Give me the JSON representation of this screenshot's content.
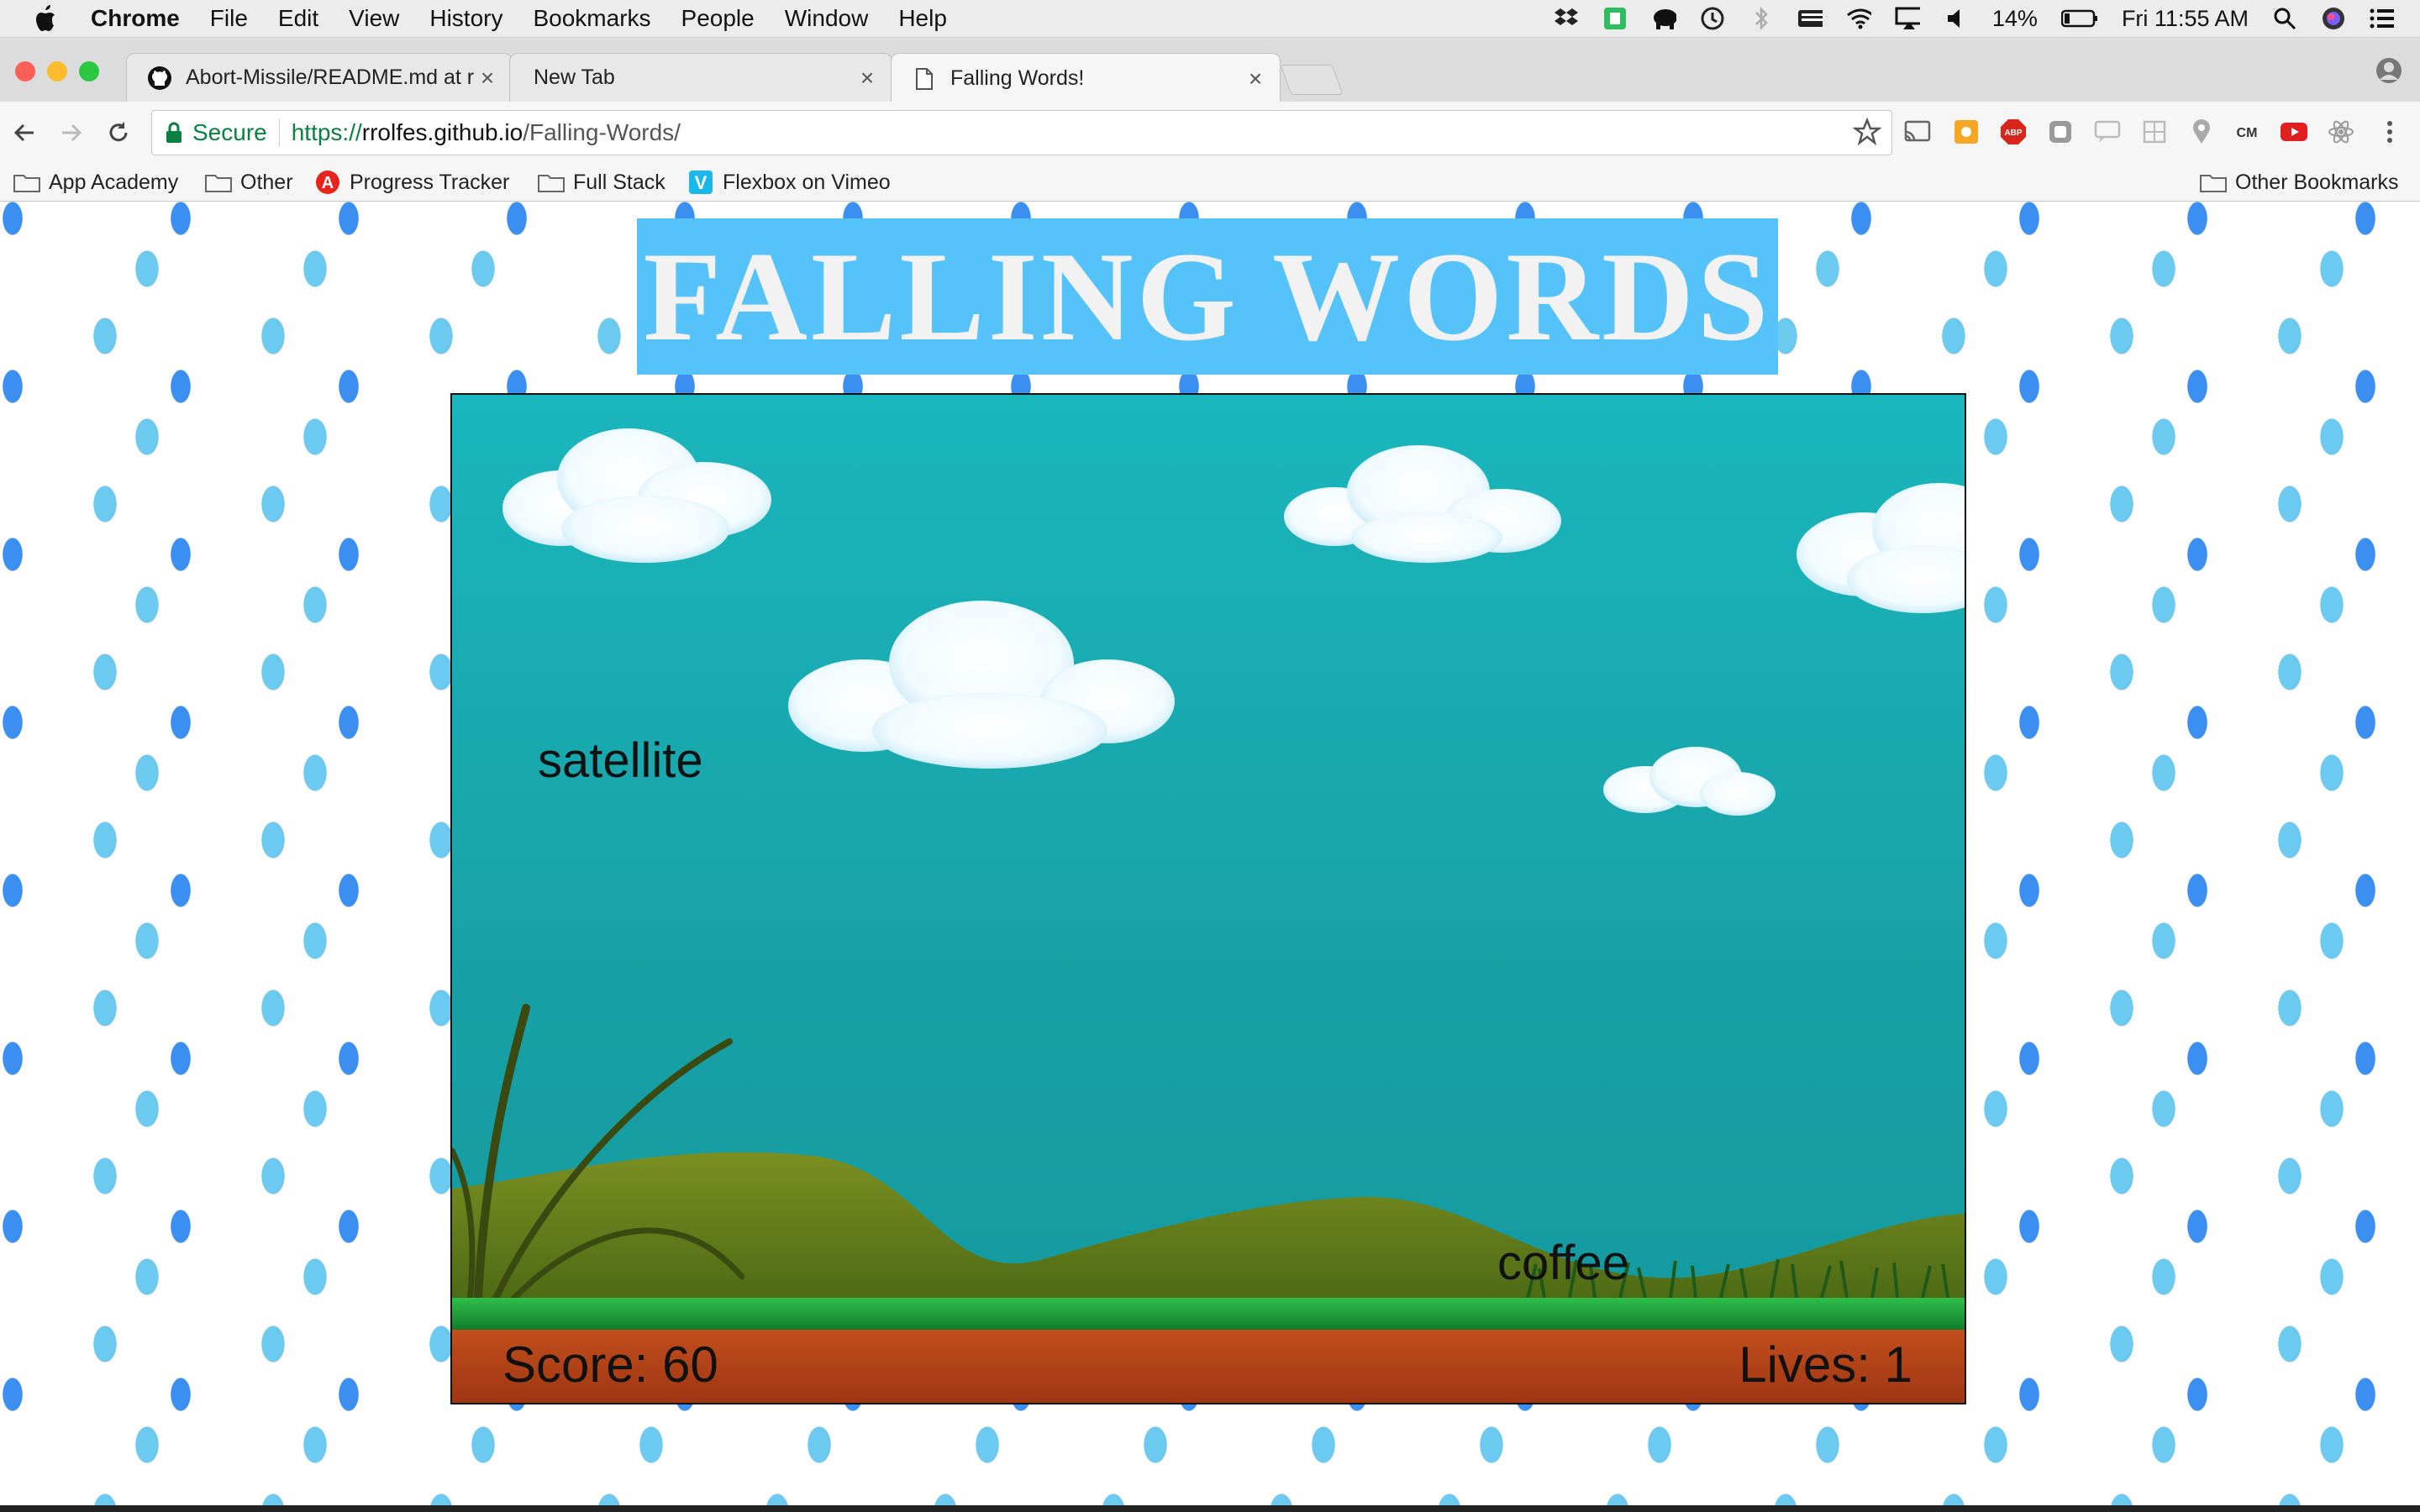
{
  "menubar": {
    "app": "Chrome",
    "items": [
      "File",
      "Edit",
      "View",
      "History",
      "Bookmarks",
      "People",
      "Window",
      "Help"
    ],
    "battery": "14%",
    "clock": "Fri 11:55 AM",
    "icons": [
      "dropbox-icon",
      "evernote-icon",
      "elephant-icon",
      "time-machine-icon",
      "bluetooth-icon",
      "keyboard-icon",
      "wifi-icon",
      "airplay-icon",
      "volume-icon",
      "battery-icon",
      "spotlight-icon",
      "siri-icon",
      "notification-center-icon"
    ]
  },
  "tabs": [
    {
      "title": "Abort-Missile/README.md at r",
      "icon": "github-icon"
    },
    {
      "title": "New Tab",
      "icon": ""
    },
    {
      "title": "Falling Words!",
      "icon": "page-icon"
    }
  ],
  "address": {
    "secure_label": "Secure",
    "scheme": "https://",
    "host": "rrolfes.github.io",
    "path": "/Falling-Words/"
  },
  "bookmarks": {
    "items": [
      {
        "label": "App Academy",
        "icon": "folder-icon"
      },
      {
        "label": "Other",
        "icon": "folder-icon"
      },
      {
        "label": "Progress Tracker",
        "icon": "app-academy-icon"
      },
      {
        "label": "Full Stack",
        "icon": "folder-icon"
      },
      {
        "label": "Flexbox on Vimeo",
        "icon": "vimeo-icon"
      }
    ],
    "other": "Other Bookmarks"
  },
  "game": {
    "title": "FALLING WORDS",
    "words": [
      "satellite",
      "coffee"
    ],
    "score_text": "Score: 60",
    "lives_text": "Lives: 1"
  },
  "colors": {
    "banner": "#55c2f9",
    "sky": "#17a9ae",
    "ground": "#b8441a",
    "grass": "#1f9a3a"
  }
}
